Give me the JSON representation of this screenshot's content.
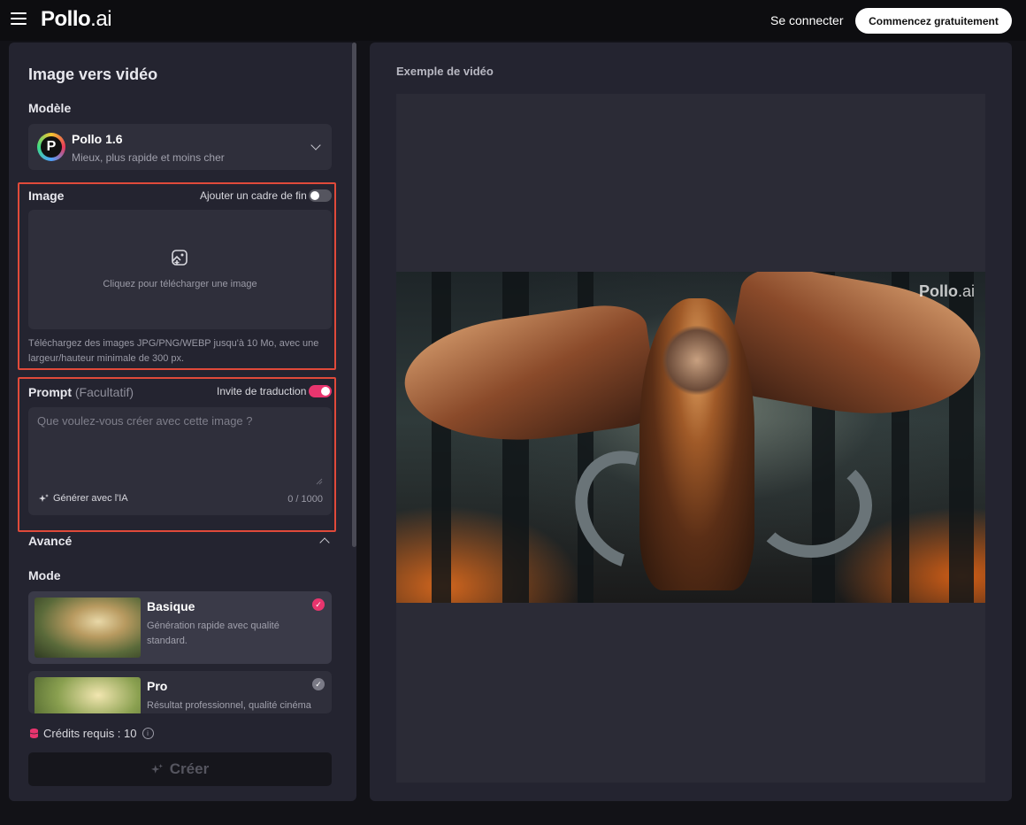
{
  "header": {
    "logo_main": "Pollo",
    "logo_suffix": ".ai",
    "login_label": "Se connecter",
    "start_label": "Commencez gratuitement"
  },
  "sidebar": {
    "title": "Image vers vidéo",
    "model_label": "Modèle",
    "model": {
      "logo_letter": "P",
      "name": "Pollo 1.6",
      "description": "Mieux, plus rapide et moins cher"
    },
    "image": {
      "label": "Image",
      "end_frame_label": "Ajouter un cadre de fin",
      "end_frame_enabled": false,
      "upload_text": "Cliquez pour télécharger une image",
      "hint": "Téléchargez des images JPG/PNG/WEBP jusqu'à 10 Mo, avec une largeur/hauteur minimale de 300 px."
    },
    "prompt": {
      "label": "Prompt",
      "optional": "(Facultatif)",
      "translate_label": "Invite de traduction",
      "translate_enabled": true,
      "placeholder": "Que voulez-vous créer avec cette image ?",
      "generate_ai_label": "Générer avec l'IA",
      "counter": "0 / 1000"
    },
    "advanced_label": "Avancé",
    "mode_label": "Mode",
    "modes": [
      {
        "name": "Basique",
        "description": "Génération rapide avec qualité standard.",
        "selected": true
      },
      {
        "name": "Pro",
        "description": "Résultat professionnel, qualité cinéma",
        "selected": false
      }
    ],
    "credits_label": "Crédits requis : 10",
    "create_label": "Créer"
  },
  "preview": {
    "title": "Exemple de vidéo",
    "watermark_main": "Pollo",
    "watermark_suffix": ".ai"
  },
  "colors": {
    "accent": "#e8356e",
    "highlight_border": "#e04a3a",
    "panel": "#242430",
    "card": "#2f2f3b"
  }
}
